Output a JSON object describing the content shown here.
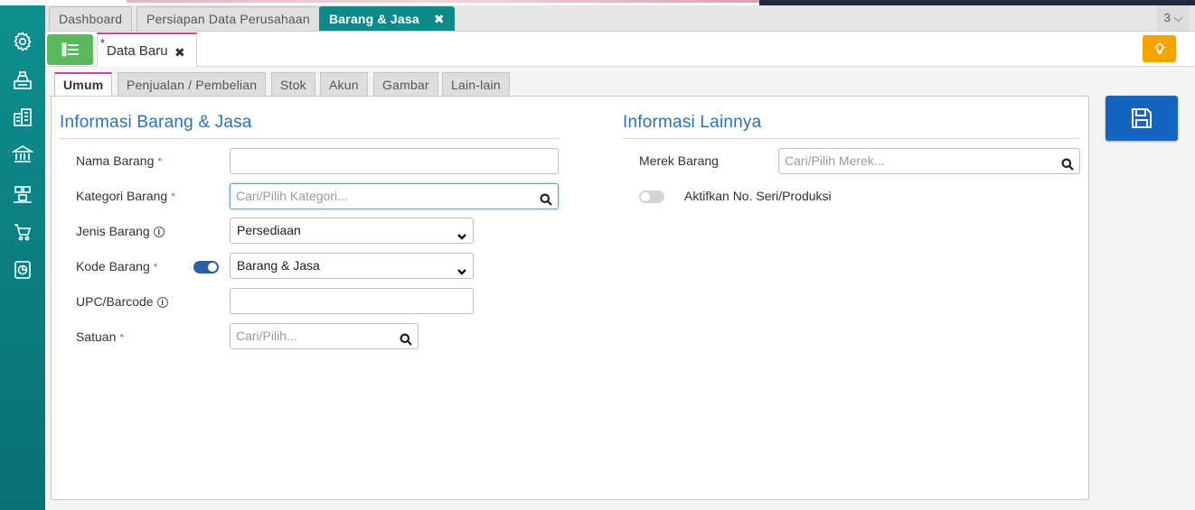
{
  "top_tabs": [
    {
      "label": "Dashboard"
    },
    {
      "label": "Persiapan Data Perusahaan"
    },
    {
      "label": "Barang & Jasa",
      "close": "✖"
    }
  ],
  "tab_count": "3 ⌵",
  "doc_tab": {
    "star": "*",
    "label": "Data Baru",
    "close": "✖"
  },
  "inner_tabs": [
    "Umum",
    "Penjualan / Pembelian",
    "Stok",
    "Akun",
    "Gambar",
    "Lain-lain"
  ],
  "left_section": {
    "title": "Informasi Barang & Jasa",
    "fields": {
      "nama_barang": {
        "label": "Nama Barang",
        "required": "*",
        "value": ""
      },
      "kategori_barang": {
        "label": "Kategori Barang",
        "required": "*",
        "placeholder": "Cari/Pilih Kategori..."
      },
      "jenis_barang": {
        "label": "Jenis Barang",
        "info": "i",
        "value": "Persediaan"
      },
      "kode_barang": {
        "label": "Kode Barang",
        "required": "*",
        "value": "Barang & Jasa",
        "toggle_on": true
      },
      "upc_barcode": {
        "label": "UPC/Barcode",
        "info": "i",
        "value": ""
      },
      "satuan": {
        "label": "Satuan",
        "required": "*",
        "placeholder": "Cari/Pilih..."
      }
    }
  },
  "right_section": {
    "title": "Informasi Lainnya",
    "merek_barang": {
      "label": "Merek Barang",
      "placeholder": "Cari/Pilih Merek..."
    },
    "aktifkan_seri": {
      "label": "Aktifkan No. Seri/Produksi",
      "toggle_on": false
    }
  },
  "colors": {
    "sidebar": "#0d8a8a",
    "active_tab": "#0d8a8a",
    "menu_button": "#5cb85c",
    "bulb_button": "#f5a300",
    "save_button": "#1565c0",
    "section_title": "#2a73b8",
    "required": "#d9534f"
  },
  "icons": {
    "sidebar": [
      "gear-icon",
      "cash-register-icon",
      "building-icon",
      "bank-icon",
      "inventory-icon",
      "cart-icon",
      "report-icon"
    ],
    "menu": "list-icon",
    "bulb": "lightbulb-icon",
    "save": "save-icon"
  }
}
